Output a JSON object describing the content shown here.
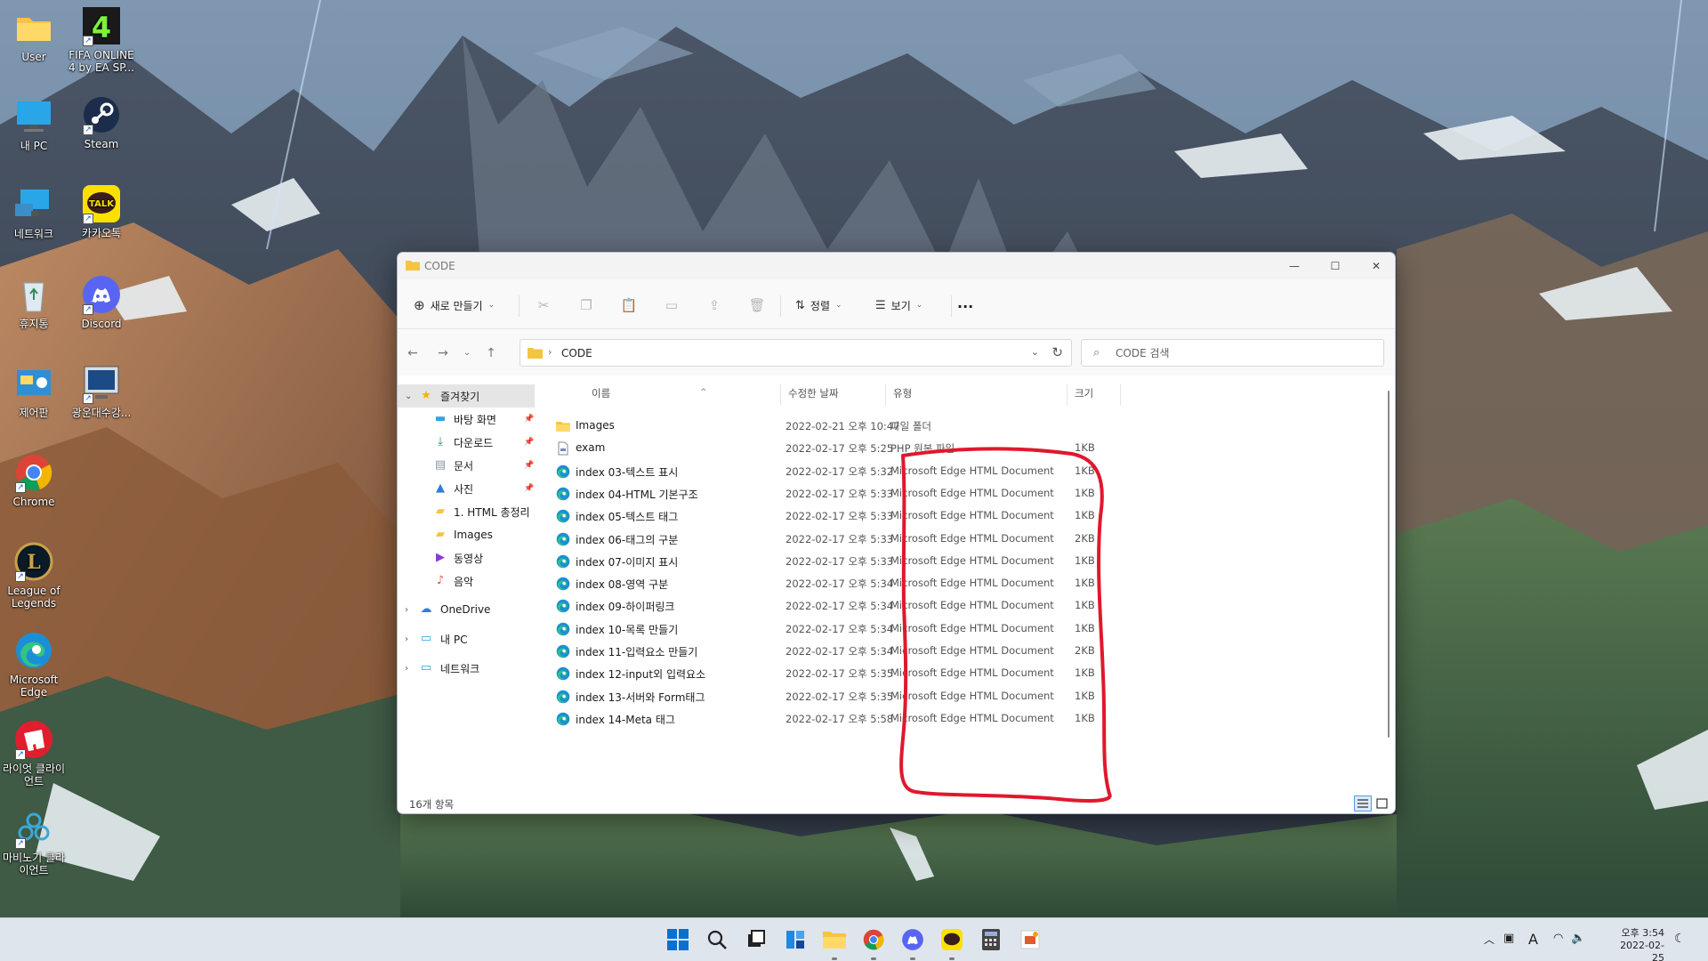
{
  "desktop": {
    "icons": [
      {
        "label": "User"
      },
      {
        "label": "FIFA ONLINE 4 by EA SP..."
      },
      {
        "label": "내 PC"
      },
      {
        "label": "Steam"
      },
      {
        "label": "네트워크"
      },
      {
        "label": "카카오톡"
      },
      {
        "label": "휴지통"
      },
      {
        "label": "Discord"
      },
      {
        "label": "제어판"
      },
      {
        "label": "광운대수강..."
      },
      {
        "label": "Chrome"
      },
      {
        "label": "League of Legends"
      },
      {
        "label": "Microsoft Edge"
      },
      {
        "label": "라이엇 클라이언트"
      },
      {
        "label": "마비노기 클라이언트"
      }
    ]
  },
  "window": {
    "title": "CODE",
    "toolbar": {
      "new_label": "새로 만들기",
      "sort_label": "정렬",
      "view_label": "보기",
      "more_label": "..."
    },
    "address": {
      "path": "CODE"
    },
    "search": {
      "placeholder": "CODE 검색"
    },
    "sidebar": {
      "items": [
        {
          "label": "즐겨찾기",
          "icon": "star-icon"
        },
        {
          "label": "바탕 화면",
          "icon": "desktop-icon"
        },
        {
          "label": "다운로드",
          "icon": "download-icon"
        },
        {
          "label": "문서",
          "icon": "document-icon"
        },
        {
          "label": "사진",
          "icon": "picture-icon"
        },
        {
          "label": "1. HTML 총정리",
          "icon": "folder-icon"
        },
        {
          "label": "Images",
          "icon": "folder-icon"
        },
        {
          "label": "동영상",
          "icon": "video-icon"
        },
        {
          "label": "음악",
          "icon": "music-icon"
        },
        {
          "label": "OneDrive",
          "icon": "cloud-icon"
        },
        {
          "label": "내 PC",
          "icon": "pc-icon"
        },
        {
          "label": "네트워크",
          "icon": "network-icon"
        }
      ]
    },
    "columns": {
      "name": "이름",
      "date": "수정한 날짜",
      "type": "유형",
      "size": "크기"
    },
    "files": [
      {
        "name": "Images",
        "date": "2022-02-21 오후 10:47",
        "type": "파일 폴더",
        "size": "",
        "icon": "folder-icon"
      },
      {
        "name": "exam",
        "date": "2022-02-17 오후 5:25",
        "type": "PHP 원본 파일",
        "size": "1KB",
        "icon": "php-file-icon"
      },
      {
        "name": "index 03-텍스트 표시",
        "date": "2022-02-17 오후 5:32",
        "type": "Microsoft Edge HTML Document",
        "size": "1KB",
        "icon": "edge-icon"
      },
      {
        "name": "index 04-HTML 기본구조",
        "date": "2022-02-17 오후 5:33",
        "type": "Microsoft Edge HTML Document",
        "size": "1KB",
        "icon": "edge-icon"
      },
      {
        "name": "index 05-텍스트 태그",
        "date": "2022-02-17 오후 5:33",
        "type": "Microsoft Edge HTML Document",
        "size": "1KB",
        "icon": "edge-icon"
      },
      {
        "name": "index 06-태그의 구분",
        "date": "2022-02-17 오후 5:33",
        "type": "Microsoft Edge HTML Document",
        "size": "2KB",
        "icon": "edge-icon"
      },
      {
        "name": "index 07-이미지 표시",
        "date": "2022-02-17 오후 5:33",
        "type": "Microsoft Edge HTML Document",
        "size": "1KB",
        "icon": "edge-icon"
      },
      {
        "name": "index 08-영역 구분",
        "date": "2022-02-17 오후 5:34",
        "type": "Microsoft Edge HTML Document",
        "size": "1KB",
        "icon": "edge-icon"
      },
      {
        "name": "index 09-하이퍼링크",
        "date": "2022-02-17 오후 5:34",
        "type": "Microsoft Edge HTML Document",
        "size": "1KB",
        "icon": "edge-icon"
      },
      {
        "name": "index 10-목록 만들기",
        "date": "2022-02-17 오후 5:34",
        "type": "Microsoft Edge HTML Document",
        "size": "1KB",
        "icon": "edge-icon"
      },
      {
        "name": "index 11-입력요소 만들기",
        "date": "2022-02-17 오후 5:34",
        "type": "Microsoft Edge HTML Document",
        "size": "2KB",
        "icon": "edge-icon"
      },
      {
        "name": "index 12-input외 입력요소",
        "date": "2022-02-17 오후 5:35",
        "type": "Microsoft Edge HTML Document",
        "size": "1KB",
        "icon": "edge-icon"
      },
      {
        "name": "index 13-서버와 Form태그",
        "date": "2022-02-17 오후 5:35",
        "type": "Microsoft Edge HTML Document",
        "size": "1KB",
        "icon": "edge-icon"
      },
      {
        "name": "index 14-Meta 태그",
        "date": "2022-02-17 오후 5:58",
        "type": "Microsoft Edge HTML Document",
        "size": "1KB",
        "icon": "edge-icon"
      }
    ],
    "status": {
      "item_count": "16개 항목"
    }
  },
  "taskbar": {
    "apps": [
      "start-icon",
      "search-icon",
      "task-view-icon",
      "widgets-icon",
      "file-explorer-icon",
      "chrome-icon",
      "discord-icon",
      "kakaotalk-icon",
      "calculator-icon",
      "presentation-app-icon"
    ],
    "tray": {
      "ime": "A",
      "time": "오후 3:54",
      "date": "2022-02-25"
    }
  },
  "colors": {
    "accent": "#0067c0",
    "annotation": "#e0182d",
    "folder": "#f5c443",
    "edge": "#1b8fd6"
  }
}
